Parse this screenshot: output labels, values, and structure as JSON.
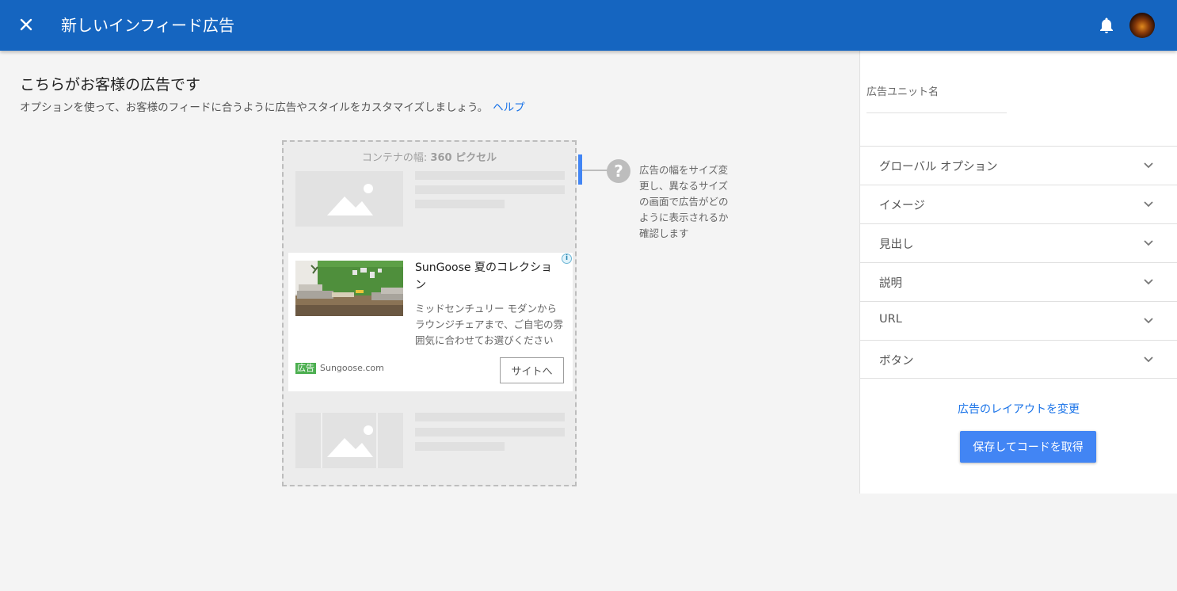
{
  "header": {
    "title": "新しいインフィード広告",
    "close_icon": "close-icon",
    "bell_icon": "notifications-icon",
    "bg_color": "#1565c0"
  },
  "main": {
    "title": "こちらがお客様の広告です",
    "subtitle": "オプションを使って、お客様のフィードに合うように広告やスタイルをカスタマイズしましょう。",
    "help_link": "ヘルプ"
  },
  "preview": {
    "width_label_prefix": "コンテナの幅: ",
    "width_value": "360 ピクセル",
    "help_tip": "広告の幅をサイズ変更し、異なるサイズの画面で広告がどのように表示されるか確認します"
  },
  "ad": {
    "headline": "SunGoose 夏のコレクション",
    "description": "ミッドセンチュリー モダンからラウンジチェアまで、ご自宅の雰囲気に合わせてお選びください",
    "badge": "広告",
    "domain": "Sungoose.com",
    "button": "サイトへ",
    "info_icon": "i"
  },
  "panel": {
    "unit_name_label": "広告ユニット名",
    "unit_name_value": "",
    "sections": [
      "グローバル オプション",
      "イメージ",
      "見出し",
      "説明",
      "URL",
      "ボタン"
    ],
    "layout_link": "広告のレイアウトを変更",
    "save_button": "保存してコードを取得",
    "accent_color": "#4285f4"
  }
}
